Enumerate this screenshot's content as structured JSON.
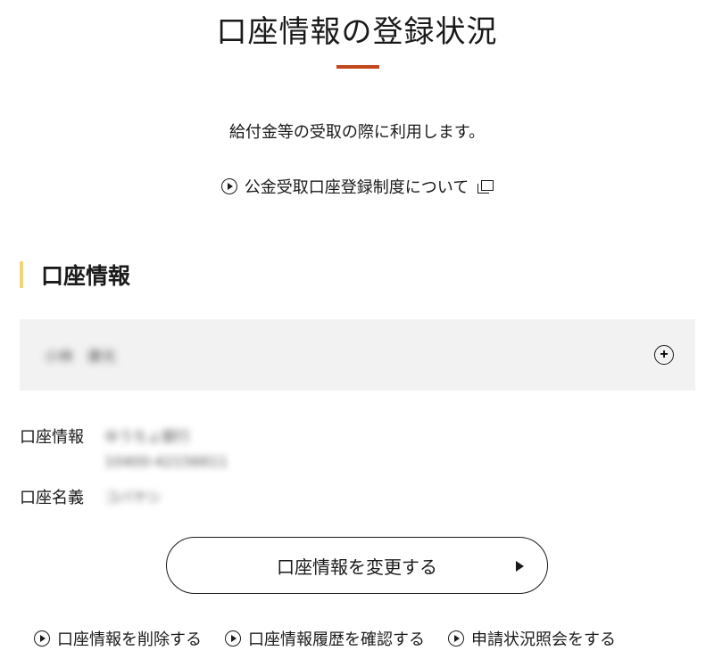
{
  "header": {
    "title": "口座情報の登録状況",
    "accent_color": "#c3461d"
  },
  "intro": {
    "subtitle": "給付金等の受取の際に利用します。",
    "about_link": "公金受取口座登録制度について"
  },
  "account_section": {
    "heading": "口座情報",
    "accent_color": "#f0d67a",
    "holder_name": "小林　康光",
    "expand_icon": "plus-circle-icon",
    "account_label": "口座情報",
    "bank_name": "ゆうちょ銀行",
    "account_number": "10400-42156611",
    "name_label": "口座名義",
    "account_holder": "コバヤシ"
  },
  "actions": {
    "change_button": "口座情報を変更する",
    "delete_link": "口座情報を削除する",
    "history_link": "口座情報履歴を確認する",
    "status_link": "申請状況照会をする"
  }
}
